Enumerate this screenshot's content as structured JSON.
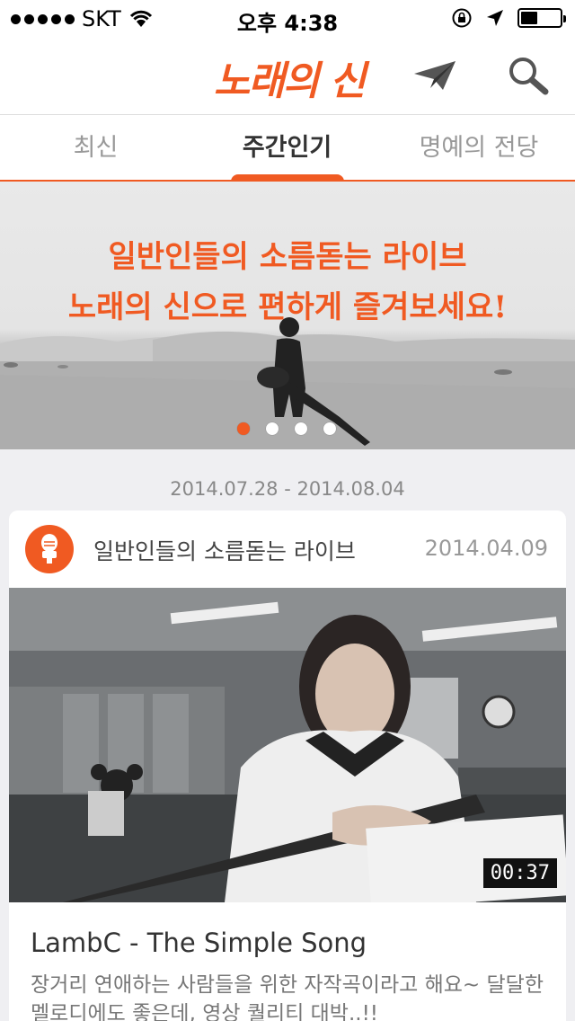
{
  "status_bar": {
    "carrier": "SKT",
    "time": "오후 4:38"
  },
  "header": {
    "logo": "노래의 신"
  },
  "tabs": [
    {
      "label": "최신"
    },
    {
      "label": "주간인기"
    },
    {
      "label": "명예의 전당"
    }
  ],
  "banner": {
    "line1": "일반인들의 소름돋는 라이브",
    "line2": "노래의 신으로 편하게 즐겨보세요!",
    "pages": 4,
    "active_page": 1
  },
  "date_range": "2014.07.28 - 2014.08.04",
  "card": {
    "channel_name": "일반인들의 소름돋는 라이브",
    "date": "2014.04.09",
    "duration": "00:37",
    "title": "LambC - The Simple Song",
    "description": "장거리 연애하는 사람들을 위한 자작곡이라고 해요~ 달달한 멜로디에도 좋은데, 영상 퀄리티 대박..!!"
  },
  "colors": {
    "accent": "#f05a22"
  }
}
